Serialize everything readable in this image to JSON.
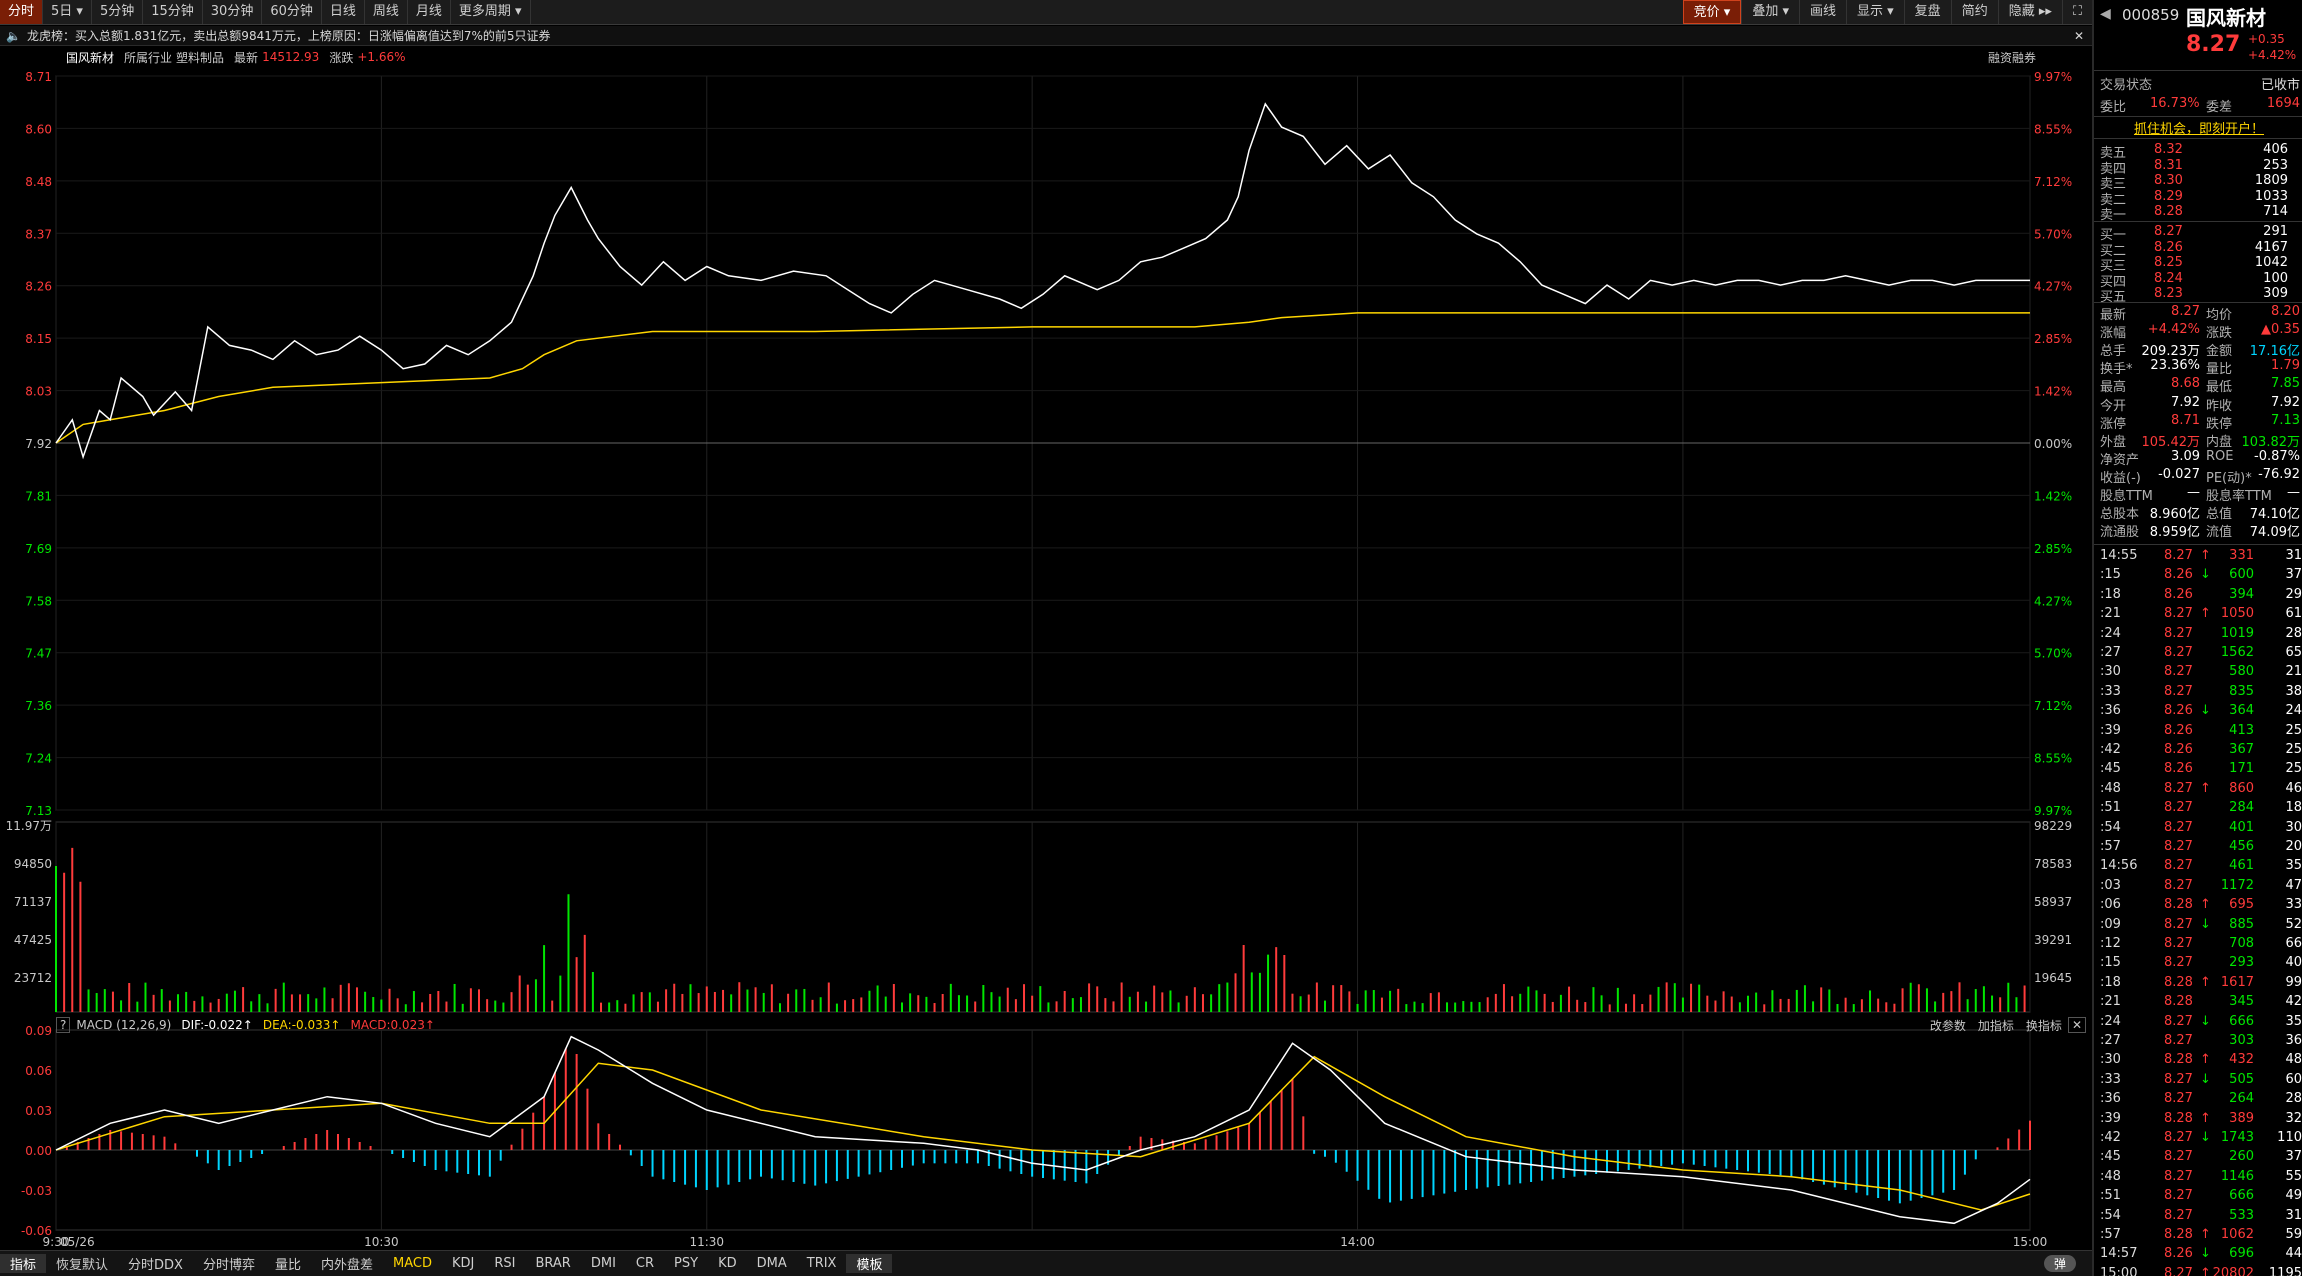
{
  "periods": [
    {
      "label": "分时",
      "active": true
    },
    {
      "label": "5日 ▾"
    },
    {
      "label": "5分钟"
    },
    {
      "label": "15分钟"
    },
    {
      "label": "30分钟"
    },
    {
      "label": "60分钟"
    },
    {
      "label": "日线"
    },
    {
      "label": "周线"
    },
    {
      "label": "月线"
    },
    {
      "label": "更多周期 ▾"
    }
  ],
  "tools": [
    {
      "label": "竞价 ▾",
      "active": true
    },
    {
      "label": "叠加 ▾"
    },
    {
      "label": "画线"
    },
    {
      "label": "显示 ▾"
    },
    {
      "label": "复盘"
    },
    {
      "label": "简约"
    },
    {
      "label": "隐藏 ▸▸"
    }
  ],
  "news": "龙虎榜：买入总额1.831亿元，卖出总额9841万元，上榜原因：日涨幅偏离值达到7%的前5只证券",
  "info": {
    "name": "国风新材",
    "industry_label": "所属行业",
    "industry": "塑料制品",
    "latest_label": "最新",
    "latest": "14512.93",
    "change_label": "涨跌",
    "change": "+1.66%",
    "margin": "融资融券"
  },
  "stock": {
    "code": "000859",
    "name": "国风新材",
    "price": "8.27",
    "chg": "+0.35",
    "pct": "+4.42%"
  },
  "status": {
    "label": "交易状态",
    "value": "已收市"
  },
  "weibi": {
    "label": "委比",
    "value": "16.73%",
    "label2": "委差",
    "value2": "1694"
  },
  "promo": "抓住机会，即刻开户！",
  "asks": [
    {
      "n": "卖五",
      "p": "8.32",
      "v": "406"
    },
    {
      "n": "卖四",
      "p": "8.31",
      "v": "253"
    },
    {
      "n": "卖三",
      "p": "8.30",
      "v": "1809"
    },
    {
      "n": "卖二",
      "p": "8.29",
      "v": "1033"
    },
    {
      "n": "卖一",
      "p": "8.28",
      "v": "714"
    }
  ],
  "bids": [
    {
      "n": "买一",
      "p": "8.27",
      "v": "291"
    },
    {
      "n": "买二",
      "p": "8.26",
      "v": "4167"
    },
    {
      "n": "买三",
      "p": "8.25",
      "v": "1042"
    },
    {
      "n": "买四",
      "p": "8.24",
      "v": "100"
    },
    {
      "n": "买五",
      "p": "8.23",
      "v": "309"
    }
  ],
  "quote": [
    {
      "l1": "最新",
      "v1": "8.27",
      "c1": "red",
      "l2": "均价",
      "v2": "8.20",
      "c2": "red"
    },
    {
      "l1": "涨幅",
      "v1": "+4.42%",
      "c1": "red",
      "l2": "涨跌",
      "v2": "▲0.35",
      "c2": "red"
    },
    {
      "l1": "总手",
      "v1": "209.23万",
      "c1": "white",
      "l2": "金额",
      "v2": "17.16亿",
      "c2": "blue"
    },
    {
      "l1": "换手*",
      "v1": "23.36%",
      "c1": "white",
      "l2": "量比",
      "v2": "1.79",
      "c2": "red"
    },
    {
      "l1": "最高",
      "v1": "8.68",
      "c1": "red",
      "l2": "最低",
      "v2": "7.85",
      "c2": "green"
    },
    {
      "l1": "今开",
      "v1": "7.92",
      "c1": "white",
      "l2": "昨收",
      "v2": "7.92",
      "c2": "white"
    },
    {
      "l1": "涨停",
      "v1": "8.71",
      "c1": "red",
      "l2": "跌停",
      "v2": "7.13",
      "c2": "green"
    },
    {
      "l1": "外盘",
      "v1": "105.42万",
      "c1": "red",
      "l2": "内盘",
      "v2": "103.82万",
      "c2": "green"
    },
    {
      "l1": "净资产",
      "v1": "3.09",
      "c1": "white",
      "l2": "ROE",
      "v2": "-0.87%",
      "c2": "white"
    },
    {
      "l1": "收益(-)",
      "v1": "-0.027",
      "c1": "white",
      "l2": "PE(动)*",
      "v2": "-76.92",
      "c2": "white"
    },
    {
      "l1": "股息TTM",
      "v1": "—",
      "c1": "white",
      "l2": "股息率TTM",
      "v2": "—",
      "c2": "white"
    },
    {
      "l1": "总股本",
      "v1": "8.960亿",
      "c1": "white",
      "l2": "总值",
      "v2": "74.10亿",
      "c2": "white"
    },
    {
      "l1": "流通股",
      "v1": "8.959亿",
      "c1": "white",
      "l2": "流值",
      "v2": "74.09亿",
      "c2": "white"
    }
  ],
  "ticks": [
    {
      "t": "14:55",
      "p": "8.27",
      "a": "↑",
      "v": "331",
      "n": "31"
    },
    {
      "t": ":15",
      "p": "8.26",
      "a": "↓",
      "v": "600",
      "n": "37"
    },
    {
      "t": ":18",
      "p": "8.26",
      "a": "",
      "v": "394",
      "n": "29"
    },
    {
      "t": ":21",
      "p": "8.27",
      "a": "↑",
      "v": "1050",
      "n": "61"
    },
    {
      "t": ":24",
      "p": "8.27",
      "a": "",
      "v": "1019",
      "n": "28"
    },
    {
      "t": ":27",
      "p": "8.27",
      "a": "",
      "v": "1562",
      "n": "65"
    },
    {
      "t": ":30",
      "p": "8.27",
      "a": "",
      "v": "580",
      "n": "21"
    },
    {
      "t": ":33",
      "p": "8.27",
      "a": "",
      "v": "835",
      "n": "38"
    },
    {
      "t": ":36",
      "p": "8.26",
      "a": "↓",
      "v": "364",
      "n": "24"
    },
    {
      "t": ":39",
      "p": "8.26",
      "a": "",
      "v": "413",
      "n": "25"
    },
    {
      "t": ":42",
      "p": "8.26",
      "a": "",
      "v": "367",
      "n": "25"
    },
    {
      "t": ":45",
      "p": "8.26",
      "a": "",
      "v": "171",
      "n": "25"
    },
    {
      "t": ":48",
      "p": "8.27",
      "a": "↑",
      "v": "860",
      "n": "46"
    },
    {
      "t": ":51",
      "p": "8.27",
      "a": "",
      "v": "284",
      "n": "18"
    },
    {
      "t": ":54",
      "p": "8.27",
      "a": "",
      "v": "401",
      "n": "30"
    },
    {
      "t": ":57",
      "p": "8.27",
      "a": "",
      "v": "456",
      "n": "20"
    },
    {
      "t": "14:56",
      "p": "8.27",
      "a": "",
      "v": "461",
      "n": "35"
    },
    {
      "t": ":03",
      "p": "8.27",
      "a": "",
      "v": "1172",
      "n": "47"
    },
    {
      "t": ":06",
      "p": "8.28",
      "a": "↑",
      "v": "695",
      "n": "33"
    },
    {
      "t": ":09",
      "p": "8.27",
      "a": "↓",
      "v": "885",
      "n": "52"
    },
    {
      "t": ":12",
      "p": "8.27",
      "a": "",
      "v": "708",
      "n": "66"
    },
    {
      "t": ":15",
      "p": "8.27",
      "a": "",
      "v": "293",
      "n": "40"
    },
    {
      "t": ":18",
      "p": "8.28",
      "a": "↑",
      "v": "1617",
      "n": "99"
    },
    {
      "t": ":21",
      "p": "8.28",
      "a": "",
      "v": "345",
      "n": "42"
    },
    {
      "t": ":24",
      "p": "8.27",
      "a": "↓",
      "v": "666",
      "n": "35"
    },
    {
      "t": ":27",
      "p": "8.27",
      "a": "",
      "v": "303",
      "n": "36"
    },
    {
      "t": ":30",
      "p": "8.28",
      "a": "↑",
      "v": "432",
      "n": "48"
    },
    {
      "t": ":33",
      "p": "8.27",
      "a": "↓",
      "v": "505",
      "n": "60"
    },
    {
      "t": ":36",
      "p": "8.27",
      "a": "",
      "v": "264",
      "n": "28"
    },
    {
      "t": ":39",
      "p": "8.28",
      "a": "↑",
      "v": "389",
      "n": "32"
    },
    {
      "t": ":42",
      "p": "8.27",
      "a": "↓",
      "v": "1743",
      "n": "110"
    },
    {
      "t": ":45",
      "p": "8.27",
      "a": "",
      "v": "260",
      "n": "37"
    },
    {
      "t": ":48",
      "p": "8.27",
      "a": "",
      "v": "1146",
      "n": "55"
    },
    {
      "t": ":51",
      "p": "8.27",
      "a": "",
      "v": "666",
      "n": "49"
    },
    {
      "t": ":54",
      "p": "8.27",
      "a": "",
      "v": "533",
      "n": "31"
    },
    {
      "t": ":57",
      "p": "8.28",
      "a": "↑",
      "v": "1062",
      "n": "59"
    },
    {
      "t": "14:57",
      "p": "8.26",
      "a": "↓",
      "v": "696",
      "n": "44"
    },
    {
      "t": "15:00",
      "p": "8.27",
      "a": "↑",
      "v": "20802",
      "n": "1195"
    }
  ],
  "macd": {
    "name": "MACD (12,26,9)",
    "dif": "DIF:-0.022↑",
    "dea": "DEA:-0.033↑",
    "macd": "MACD:0.023↑",
    "btn1": "改参数",
    "btn2": "加指标",
    "btn3": "换指标"
  },
  "indicators": [
    {
      "label": "指标",
      "sel": true
    },
    {
      "label": "恢复默认"
    },
    {
      "label": "分时DDX"
    },
    {
      "label": "分时博弈"
    },
    {
      "label": "量比"
    },
    {
      "label": "内外盘差"
    },
    {
      "label": "MACD",
      "active": true
    },
    {
      "label": "KDJ"
    },
    {
      "label": "RSI"
    },
    {
      "label": "BRAR"
    },
    {
      "label": "DMI"
    },
    {
      "label": "CR"
    },
    {
      "label": "PSY"
    },
    {
      "label": "KD"
    },
    {
      "label": "DMA"
    },
    {
      "label": "TRIX"
    },
    {
      "label": "模板",
      "sel": true
    }
  ],
  "popup_label": "弹",
  "chart_data": {
    "type": "line",
    "price_axis": {
      "left": [
        "8.71",
        "8.60",
        "8.48",
        "8.37",
        "8.26",
        "8.15",
        "8.03",
        "7.92",
        "7.81",
        "7.69",
        "7.58",
        "7.47",
        "7.36",
        "7.24",
        "7.13"
      ],
      "right": [
        "9.97%",
        "8.55%",
        "7.12%",
        "5.70%",
        "4.27%",
        "2.85%",
        "1.42%",
        "0.00%",
        "1.42%",
        "2.85%",
        "4.27%",
        "5.70%",
        "7.12%",
        "8.55%",
        "9.97%"
      ],
      "range": [
        7.13,
        8.71
      ],
      "prev_close": 7.92
    },
    "vol_axis": {
      "left": [
        "11.97万",
        "94850",
        "71137",
        "47425",
        "23712"
      ],
      "right": [
        "98229",
        "78583",
        "58937",
        "39291",
        "19645"
      ]
    },
    "macd_axis": {
      "left": [
        "0.09",
        "0.06",
        "0.03",
        "0.00",
        "-0.03",
        "-0.06"
      ],
      "range": [
        -0.06,
        0.09
      ]
    },
    "time_labels": [
      "05/26",
      "9:30",
      "10:30",
      "11:30",
      "14:00",
      "15:00"
    ],
    "price": [
      [
        0,
        7.92
      ],
      [
        3,
        7.97
      ],
      [
        5,
        7.89
      ],
      [
        8,
        7.99
      ],
      [
        10,
        7.97
      ],
      [
        12,
        8.06
      ],
      [
        16,
        8.02
      ],
      [
        18,
        7.98
      ],
      [
        22,
        8.03
      ],
      [
        25,
        7.99
      ],
      [
        28,
        8.17
      ],
      [
        32,
        8.13
      ],
      [
        36,
        8.12
      ],
      [
        40,
        8.1
      ],
      [
        44,
        8.14
      ],
      [
        48,
        8.11
      ],
      [
        52,
        8.12
      ],
      [
        56,
        8.15
      ],
      [
        60,
        8.12
      ],
      [
        64,
        8.08
      ],
      [
        68,
        8.09
      ],
      [
        72,
        8.13
      ],
      [
        76,
        8.11
      ],
      [
        80,
        8.14
      ],
      [
        84,
        8.18
      ],
      [
        88,
        8.28
      ],
      [
        90,
        8.35
      ],
      [
        92,
        8.41
      ],
      [
        95,
        8.47
      ],
      [
        98,
        8.4
      ],
      [
        100,
        8.36
      ],
      [
        104,
        8.3
      ],
      [
        108,
        8.26
      ],
      [
        112,
        8.31
      ],
      [
        116,
        8.27
      ],
      [
        120,
        8.3
      ],
      [
        124,
        8.28
      ],
      [
        130,
        8.27
      ],
      [
        136,
        8.29
      ],
      [
        142,
        8.28
      ],
      [
        146,
        8.25
      ],
      [
        150,
        8.22
      ],
      [
        154,
        8.2
      ],
      [
        158,
        8.24
      ],
      [
        162,
        8.27
      ],
      [
        168,
        8.25
      ],
      [
        174,
        8.23
      ],
      [
        178,
        8.21
      ],
      [
        182,
        8.24
      ],
      [
        186,
        8.28
      ],
      [
        192,
        8.25
      ],
      [
        196,
        8.27
      ],
      [
        200,
        8.31
      ],
      [
        204,
        8.32
      ],
      [
        208,
        8.34
      ],
      [
        212,
        8.36
      ],
      [
        216,
        8.4
      ],
      [
        218,
        8.45
      ],
      [
        220,
        8.55
      ],
      [
        223,
        8.65
      ],
      [
        226,
        8.6
      ],
      [
        230,
        8.58
      ],
      [
        234,
        8.52
      ],
      [
        238,
        8.56
      ],
      [
        242,
        8.51
      ],
      [
        246,
        8.54
      ],
      [
        250,
        8.48
      ],
      [
        254,
        8.45
      ],
      [
        258,
        8.4
      ],
      [
        262,
        8.37
      ],
      [
        266,
        8.35
      ],
      [
        270,
        8.31
      ],
      [
        274,
        8.26
      ],
      [
        278,
        8.24
      ],
      [
        282,
        8.22
      ],
      [
        286,
        8.26
      ],
      [
        290,
        8.23
      ],
      [
        294,
        8.27
      ],
      [
        298,
        8.26
      ],
      [
        302,
        8.27
      ],
      [
        306,
        8.26
      ],
      [
        310,
        8.27
      ],
      [
        314,
        8.27
      ],
      [
        318,
        8.26
      ],
      [
        322,
        8.27
      ],
      [
        326,
        8.27
      ],
      [
        330,
        8.28
      ],
      [
        334,
        8.27
      ],
      [
        338,
        8.26
      ],
      [
        342,
        8.27
      ],
      [
        346,
        8.27
      ],
      [
        350,
        8.26
      ],
      [
        354,
        8.27
      ],
      [
        358,
        8.27
      ],
      [
        362,
        8.27
      ],
      [
        364,
        8.27
      ]
    ],
    "avg": [
      [
        0,
        7.92
      ],
      [
        5,
        7.96
      ],
      [
        10,
        7.97
      ],
      [
        20,
        7.99
      ],
      [
        30,
        8.02
      ],
      [
        40,
        8.04
      ],
      [
        60,
        8.05
      ],
      [
        80,
        8.06
      ],
      [
        86,
        8.08
      ],
      [
        90,
        8.11
      ],
      [
        96,
        8.14
      ],
      [
        110,
        8.16
      ],
      [
        140,
        8.16
      ],
      [
        180,
        8.17
      ],
      [
        210,
        8.17
      ],
      [
        220,
        8.18
      ],
      [
        226,
        8.19
      ],
      [
        240,
        8.2
      ],
      [
        280,
        8.2
      ],
      [
        320,
        8.2
      ],
      [
        364,
        8.2
      ]
    ],
    "volume_max": 119700,
    "macd_dif": [
      [
        0,
        0.0
      ],
      [
        10,
        0.02
      ],
      [
        20,
        0.03
      ],
      [
        30,
        0.02
      ],
      [
        40,
        0.03
      ],
      [
        50,
        0.04
      ],
      [
        60,
        0.035
      ],
      [
        70,
        0.02
      ],
      [
        80,
        0.01
      ],
      [
        90,
        0.04
      ],
      [
        95,
        0.085
      ],
      [
        100,
        0.075
      ],
      [
        110,
        0.05
      ],
      [
        120,
        0.03
      ],
      [
        140,
        0.01
      ],
      [
        160,
        0.005
      ],
      [
        170,
        0.0
      ],
      [
        180,
        -0.01
      ],
      [
        190,
        -0.015
      ],
      [
        200,
        0.0
      ],
      [
        210,
        0.01
      ],
      [
        220,
        0.03
      ],
      [
        228,
        0.08
      ],
      [
        235,
        0.06
      ],
      [
        245,
        0.02
      ],
      [
        260,
        -0.005
      ],
      [
        280,
        -0.015
      ],
      [
        300,
        -0.02
      ],
      [
        320,
        -0.03
      ],
      [
        340,
        -0.05
      ],
      [
        350,
        -0.055
      ],
      [
        358,
        -0.04
      ],
      [
        364,
        -0.022
      ]
    ],
    "macd_dea": [
      [
        0,
        0.0
      ],
      [
        20,
        0.025
      ],
      [
        40,
        0.03
      ],
      [
        60,
        0.035
      ],
      [
        80,
        0.02
      ],
      [
        90,
        0.02
      ],
      [
        100,
        0.065
      ],
      [
        110,
        0.06
      ],
      [
        130,
        0.03
      ],
      [
        160,
        0.01
      ],
      [
        180,
        0.0
      ],
      [
        200,
        -0.005
      ],
      [
        220,
        0.02
      ],
      [
        232,
        0.07
      ],
      [
        245,
        0.04
      ],
      [
        260,
        0.01
      ],
      [
        280,
        -0.005
      ],
      [
        300,
        -0.015
      ],
      [
        320,
        -0.02
      ],
      [
        340,
        -0.03
      ],
      [
        355,
        -0.045
      ],
      [
        364,
        -0.033
      ]
    ]
  }
}
